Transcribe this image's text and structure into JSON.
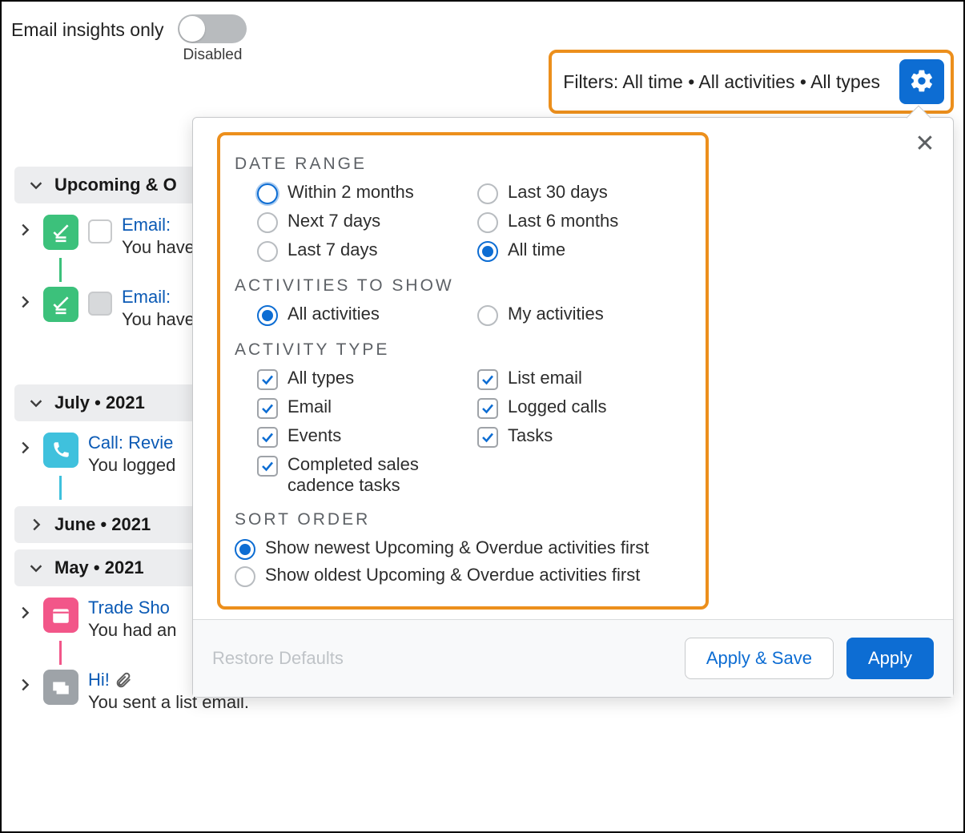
{
  "toggle": {
    "label": "Email insights only",
    "state": "Disabled"
  },
  "filter_bar": {
    "text": "Filters: All time • All activities • All types"
  },
  "timeline": {
    "sections": [
      {
        "label": "Upcoming & O"
      },
      {
        "label": "July • 2021"
      },
      {
        "label": "June • 2021"
      },
      {
        "label": "May • 2021"
      }
    ],
    "items": {
      "email1": {
        "link": "Email:",
        "sub": "You have a"
      },
      "email2": {
        "link": "Email:",
        "sub": "You have a"
      },
      "call": {
        "link": "Call: Revie",
        "sub": "You logged"
      },
      "trade": {
        "link": "Trade Sho",
        "sub": "You had an"
      },
      "hi": {
        "link": "Hi!",
        "sub": "You sent a list email."
      }
    }
  },
  "popup": {
    "date_range": {
      "title": "Date Range",
      "options": [
        {
          "label": "Within 2 months",
          "selected": false,
          "focus": true
        },
        {
          "label": "Last 30 days",
          "selected": false
        },
        {
          "label": "Next 7 days",
          "selected": false
        },
        {
          "label": "Last 6 months",
          "selected": false
        },
        {
          "label": "Last 7 days",
          "selected": false
        },
        {
          "label": "All time",
          "selected": true
        }
      ]
    },
    "activities_to_show": {
      "title": "Activities to Show",
      "options": [
        {
          "label": "All activities",
          "selected": true
        },
        {
          "label": "My activities",
          "selected": false
        }
      ]
    },
    "activity_type": {
      "title": "Activity Type",
      "options_left": [
        {
          "label": "All types",
          "checked": true
        },
        {
          "label": "Email",
          "checked": true
        },
        {
          "label": "Events",
          "checked": true
        },
        {
          "label": "Completed sales cadence tasks",
          "checked": true
        }
      ],
      "options_right": [
        {
          "label": "List email",
          "checked": true
        },
        {
          "label": "Logged calls",
          "checked": true
        },
        {
          "label": "Tasks",
          "checked": true
        }
      ]
    },
    "sort_order": {
      "title": "Sort Order",
      "options": [
        {
          "label": "Show newest Upcoming & Overdue activities first",
          "selected": true
        },
        {
          "label": "Show oldest Upcoming & Overdue activities first",
          "selected": false
        }
      ]
    },
    "footer": {
      "restore": "Restore Defaults",
      "apply_save": "Apply & Save",
      "apply": "Apply"
    }
  }
}
